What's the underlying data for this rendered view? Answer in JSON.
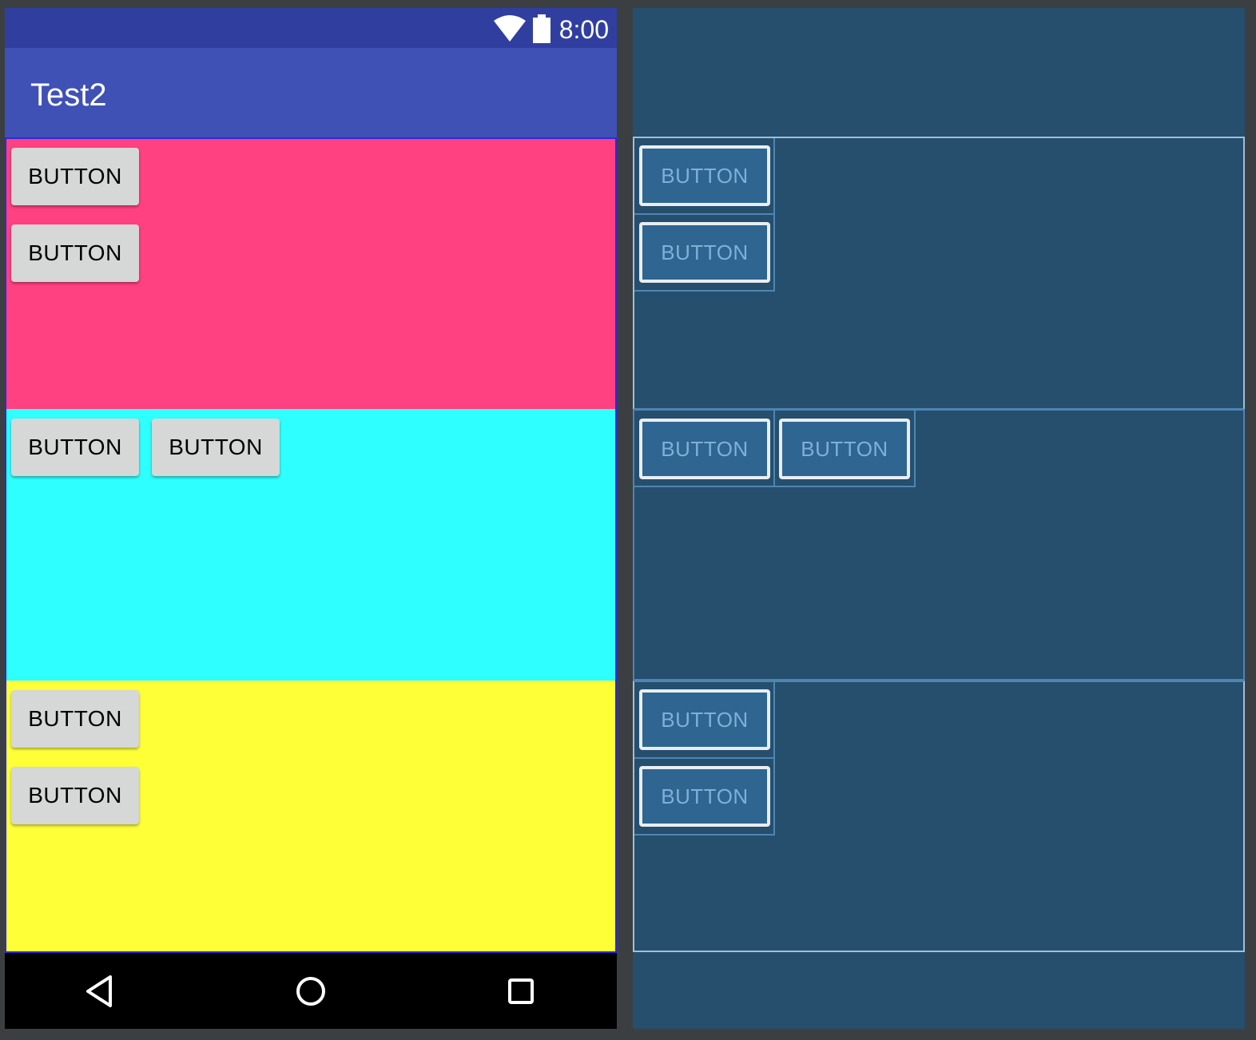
{
  "status_bar": {
    "time": "8:00",
    "icons": [
      "wifi-icon",
      "battery-icon"
    ]
  },
  "app_bar": {
    "title": "Test2"
  },
  "panels": [
    {
      "name": "pink",
      "color": "#ff4081",
      "buttons": [
        "BUTTON",
        "BUTTON"
      ]
    },
    {
      "name": "cyan",
      "color": "#2effff",
      "buttons": [
        "BUTTON",
        "BUTTON"
      ]
    },
    {
      "name": "yellow",
      "color": "#ffff38",
      "buttons": [
        "BUTTON",
        "BUTTON"
      ]
    }
  ],
  "nav_bar": {
    "icons": [
      "back-icon",
      "home-icon",
      "recents-icon"
    ]
  },
  "blueprint": {
    "panels": [
      {
        "buttons": [
          "BUTTON",
          "BUTTON"
        ]
      },
      {
        "buttons": [
          "BUTTON",
          "BUTTON"
        ]
      },
      {
        "buttons": [
          "BUTTON",
          "BUTTON"
        ]
      }
    ]
  },
  "colors": {
    "status_bar": "#303f9f",
    "app_bar": "#3f51b5",
    "blueprint_bg": "#264e6d",
    "outer_bg": "#3c3f41"
  }
}
